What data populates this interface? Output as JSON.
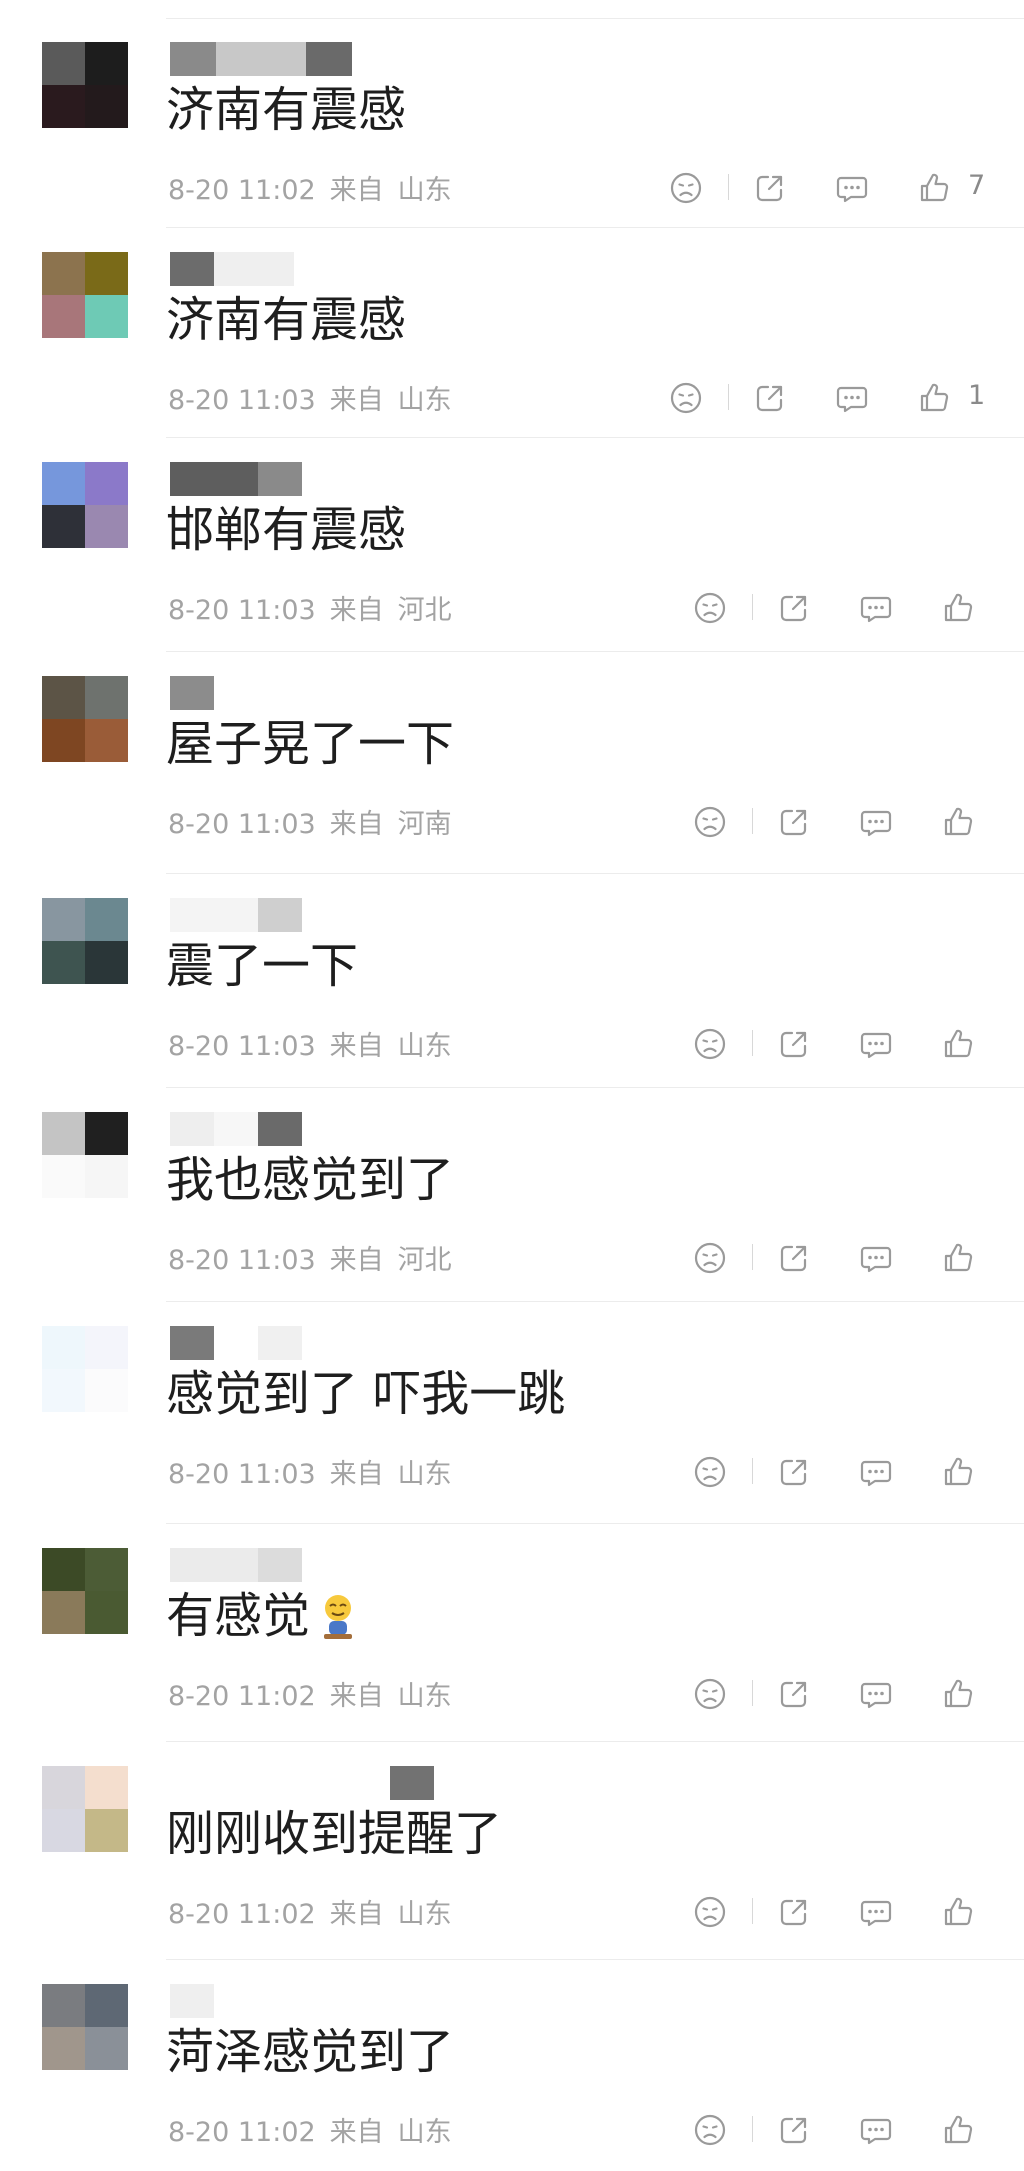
{
  "comments": [
    {
      "content": "济南有震感",
      "date": "8-20 11:02",
      "source_label": "来自",
      "location": "山东",
      "like_count": "7",
      "avatar_colors": [
        "#5a5a5a",
        "#1d1d1d",
        "#2a1a1e",
        "#231a1c"
      ],
      "name_blur": [
        [
          "#8a8a8a",
          46
        ],
        [
          "#c8c8c8",
          90
        ],
        [
          "#6a6a6a",
          46
        ]
      ]
    },
    {
      "content": "济南有震感",
      "date": "8-20 11:03",
      "source_label": "来自",
      "location": "山东",
      "like_count": "1",
      "avatar_colors": [
        "#8c734e",
        "#7a6a18",
        "#a8767a",
        "#6ecab5"
      ],
      "name_blur": [
        [
          "#6c6c6c",
          44
        ],
        [
          "#efefef",
          80
        ]
      ]
    },
    {
      "content": "邯郸有震感",
      "date": "8-20 11:03",
      "source_label": "来自",
      "location": "河北",
      "like_count": "",
      "avatar_colors": [
        "#7697dc",
        "#8b79c9",
        "#2e3038",
        "#9a88b0"
      ],
      "name_blur": [
        [
          "#5e5e5e",
          88
        ],
        [
          "#8a8a8a",
          44
        ]
      ]
    },
    {
      "content": "屋子晃了一下",
      "date": "8-20 11:03",
      "source_label": "来自",
      "location": "河南",
      "like_count": "",
      "avatar_colors": [
        "#5c5446",
        "#6e726e",
        "#7e4622",
        "#9a5c38"
      ],
      "name_blur": [
        [
          "#8c8c8c",
          44
        ]
      ]
    },
    {
      "content": "震了一下",
      "date": "8-20 11:03",
      "source_label": "来自",
      "location": "山东",
      "like_count": "",
      "avatar_colors": [
        "#8896a0",
        "#6b8890",
        "#3e5450",
        "#2a3638"
      ],
      "name_blur": [
        [
          "#f4f4f4",
          88
        ],
        [
          "#cfcfcf",
          44
        ]
      ]
    },
    {
      "content": "我也感觉到了",
      "date": "8-20 11:03",
      "source_label": "来自",
      "location": "河北",
      "like_count": "",
      "avatar_colors": [
        "#c4c4c4",
        "#202020",
        "#fafafa",
        "#f6f6f6"
      ],
      "name_blur": [
        [
          "#eeeeee",
          44
        ],
        [
          "#f7f7f7",
          44
        ],
        [
          "#6a6a6a",
          44
        ]
      ]
    },
    {
      "content": "感觉到了 吓我一跳",
      "date": "8-20 11:03",
      "source_label": "来自",
      "location": "山东",
      "like_count": "",
      "avatar_colors": [
        "#eef7fc",
        "#f4f5fb",
        "#f2f8fd",
        "#fbfbfc"
      ],
      "name_blur": [
        [
          "#7a7a7a",
          44
        ],
        [
          "#ffffff",
          44
        ],
        [
          "#f0f0f0",
          44
        ]
      ]
    },
    {
      "content": "有感觉",
      "date": "8-20 11:02",
      "source_label": "来自",
      "location": "山东",
      "like_count": "",
      "avatar_colors": [
        "#3c4a26",
        "#4c5c36",
        "#8a7a5a",
        "#4a5a32"
      ],
      "name_blur": [
        [
          "#ebebeb",
          88
        ],
        [
          "#dcdcdc",
          44
        ]
      ]
    },
    {
      "content": "刚刚收到提醒了",
      "date": "8-20 11:02",
      "source_label": "来自",
      "location": "山东",
      "like_count": "",
      "avatar_colors": [
        "#d8d6dc",
        "#f4dece",
        "#d8d8e2",
        "#c4b888"
      ],
      "name_blur": [
        [
          "#ffffff",
          220
        ],
        [
          "#727272",
          44
        ]
      ]
    },
    {
      "content": "菏泽感觉到了",
      "date": "8-20 11:02",
      "source_label": "来自",
      "location": "山东",
      "like_count": "",
      "avatar_colors": [
        "#7a7c80",
        "#5e6874",
        "#a0968c",
        "#8a9098"
      ],
      "name_blur": [
        [
          "#efefef",
          44
        ]
      ]
    }
  ]
}
